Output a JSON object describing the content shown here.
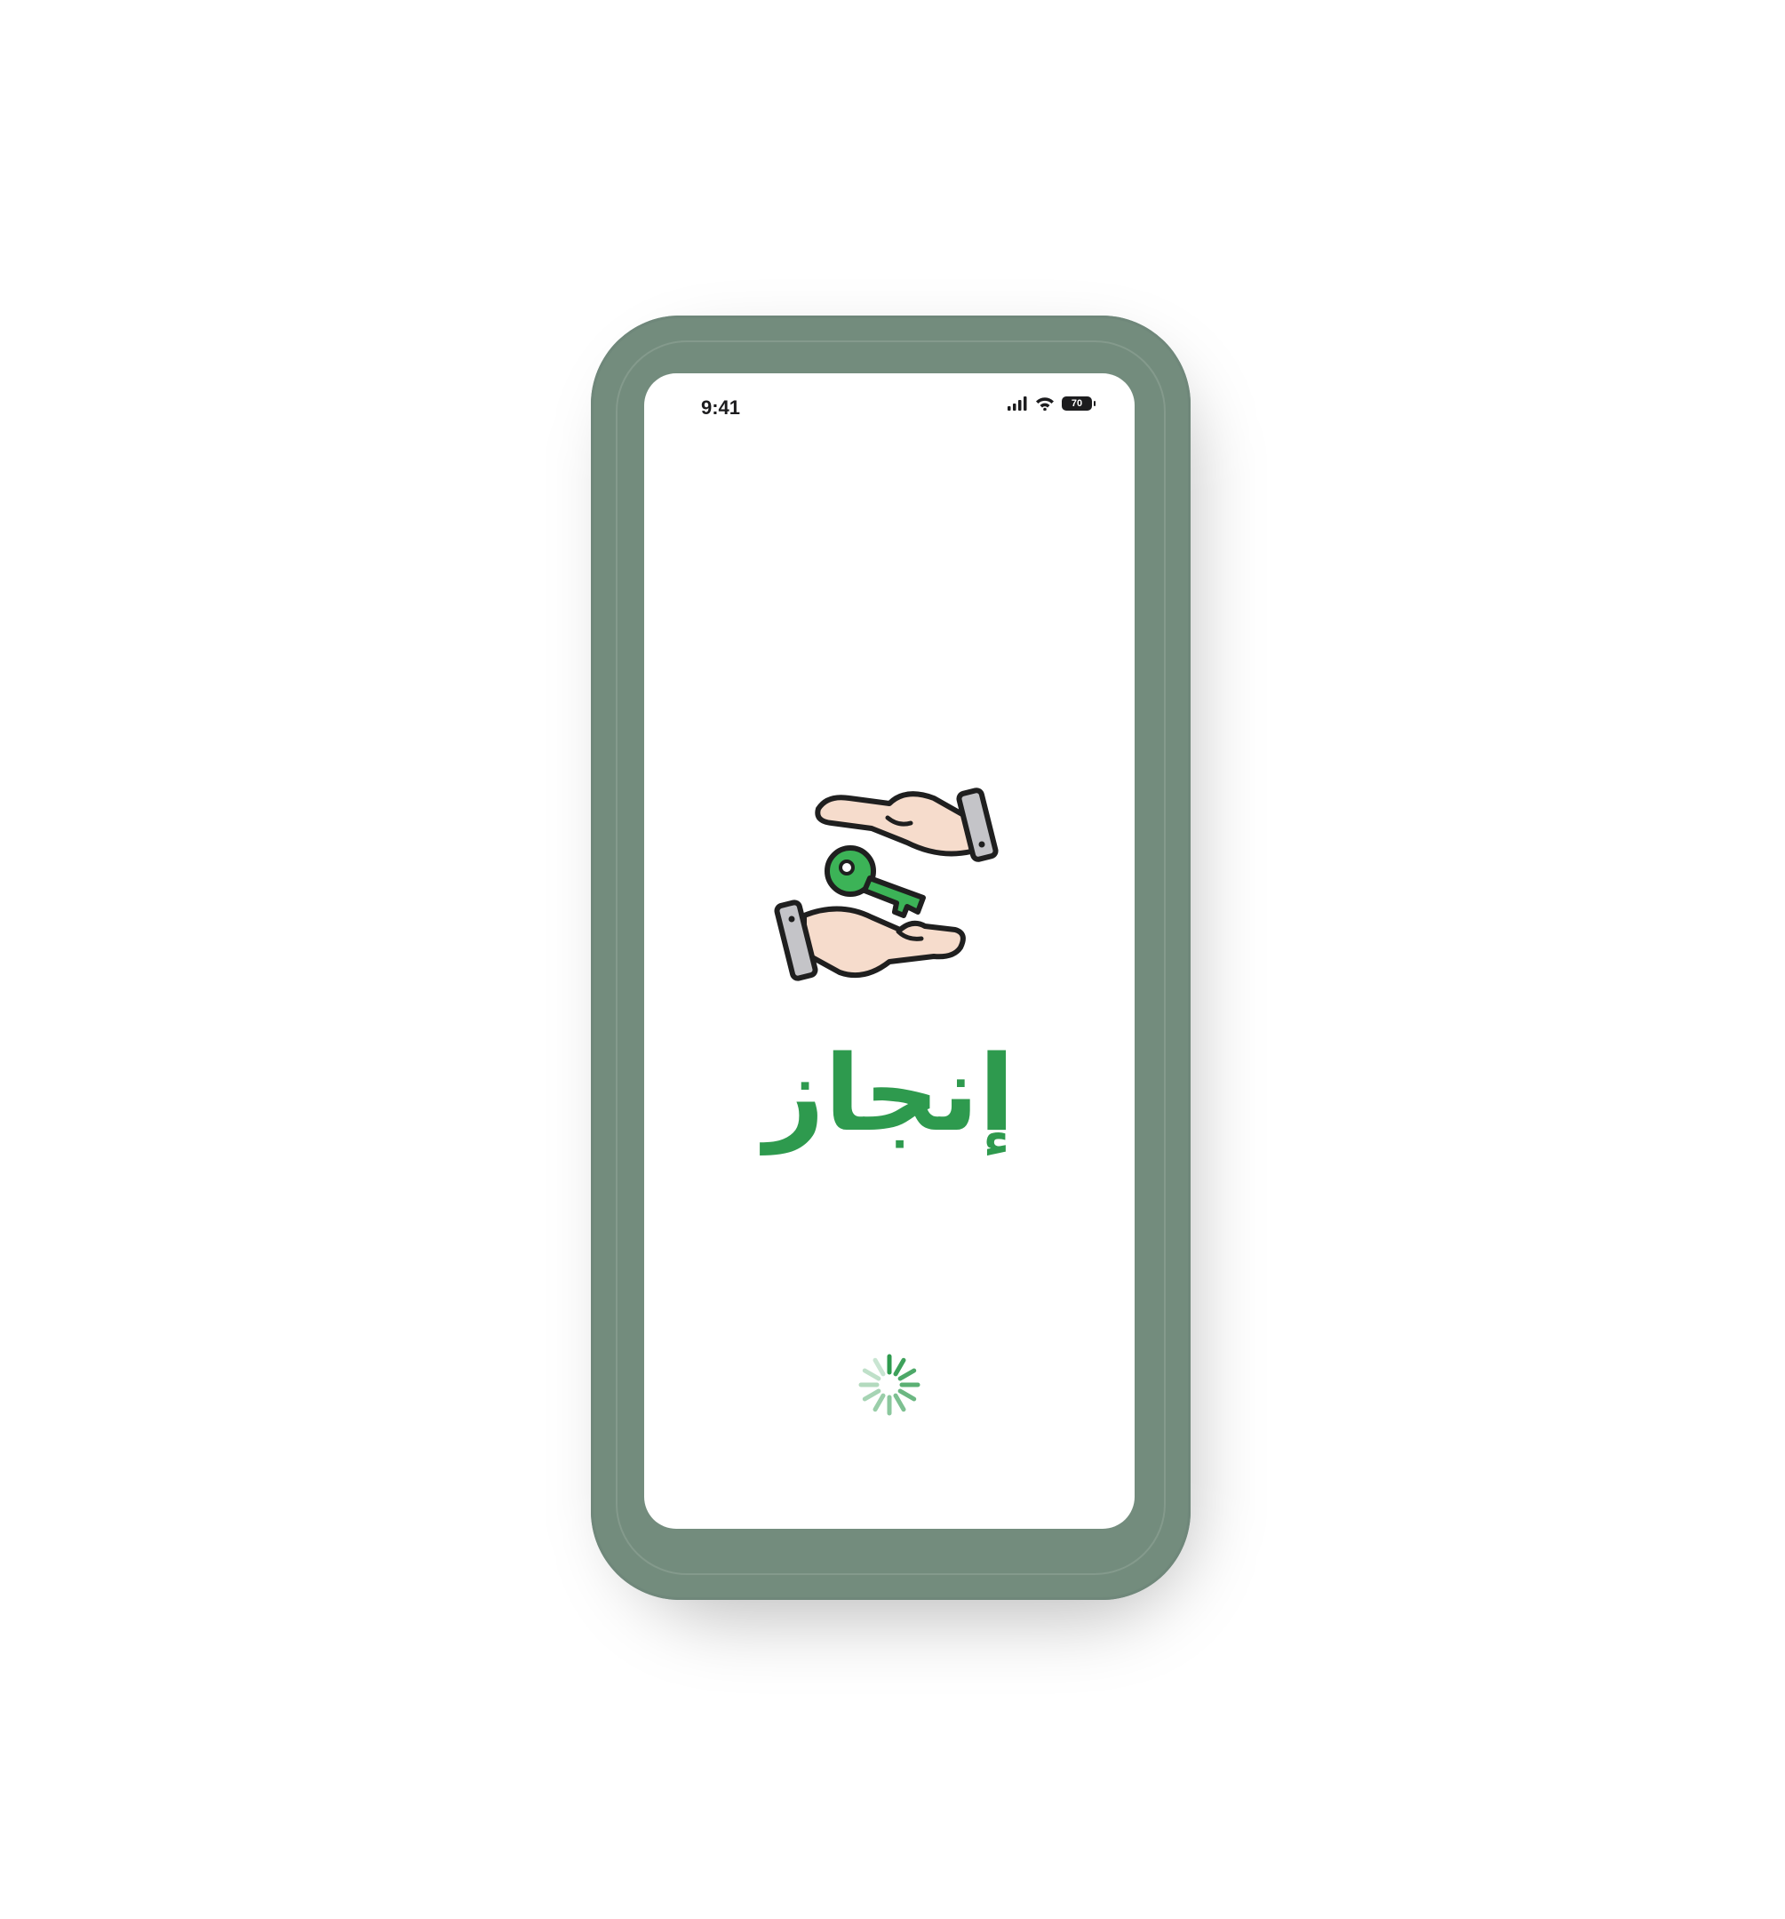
{
  "status_bar": {
    "time": "9:41",
    "battery_level": "70",
    "icons": [
      "cellular-signal-icon",
      "wifi-icon",
      "battery-icon"
    ]
  },
  "splash": {
    "logo_icon": "hands-passing-key-icon",
    "app_name": "إنجاز",
    "loading_indicator": "spinner-icon"
  },
  "colors": {
    "device_frame": "#738c7d",
    "brand_green": "#2e9a4e",
    "key_green": "#3cb357",
    "skin": "#f6dccc",
    "cuff": "#c4c4c8",
    "outline": "#1f1f1f"
  }
}
